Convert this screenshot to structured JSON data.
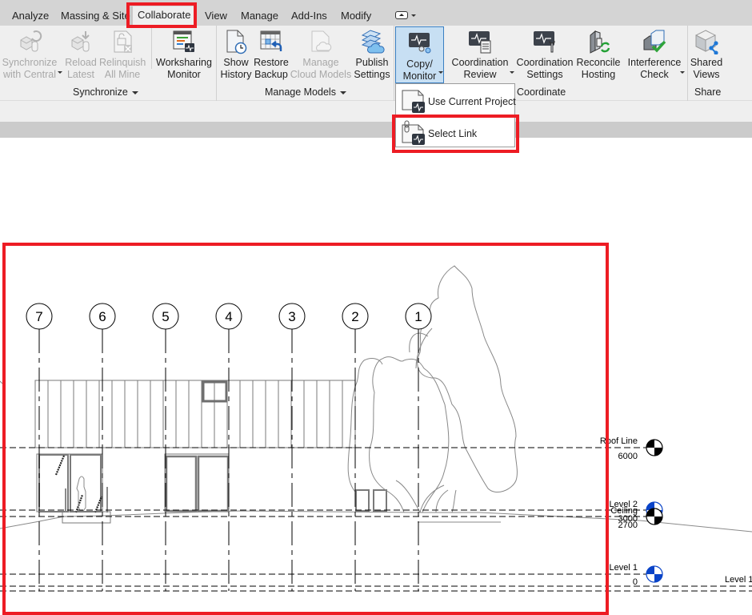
{
  "tabs": [
    {
      "label": "Analyze",
      "active": false
    },
    {
      "label": "Massing & Site",
      "active": false
    },
    {
      "label": "Collaborate",
      "active": true
    },
    {
      "label": "View",
      "active": false
    },
    {
      "label": "Manage",
      "active": false
    },
    {
      "label": "Add-Ins",
      "active": false
    },
    {
      "label": "Modify",
      "active": false
    }
  ],
  "quick_access": {
    "icon": "contextual-tab-toggle-icon"
  },
  "ribbon": {
    "panels": {
      "synchronize": {
        "title": "Synchronize",
        "buttons": [
          {
            "line1": "Synchronize",
            "line2": "with Central",
            "enabled": false,
            "split": true,
            "icon": "synchronize-icon"
          },
          {
            "line1": "Reload",
            "line2": "Latest",
            "enabled": false,
            "icon": "reload-latest-icon"
          },
          {
            "line1": "Relinquish",
            "line2": "All Mine",
            "enabled": false,
            "icon": "relinquish-icon"
          },
          {
            "line1": "Worksharing",
            "line2": "Monitor",
            "enabled": true,
            "icon": "worksharing-monitor-icon"
          }
        ]
      },
      "manage_models": {
        "title": "Manage Models",
        "buttons": [
          {
            "line1": "Show",
            "line2": "History",
            "enabled": true,
            "icon": "show-history-icon"
          },
          {
            "line1": "Restore",
            "line2": "Backup",
            "enabled": true,
            "icon": "restore-backup-icon"
          },
          {
            "line1": "Manage",
            "line2": "Cloud Models",
            "enabled": false,
            "icon": "cloud-models-icon"
          },
          {
            "line1": "Publish",
            "line2": "Settings",
            "enabled": true,
            "icon": "publish-settings-icon"
          }
        ]
      },
      "coordinate": {
        "title": "Coordinate",
        "buttons": [
          {
            "line1": "Copy/",
            "line2": "Monitor",
            "enabled": true,
            "selected": true,
            "split": true,
            "icon": "copy-monitor-icon"
          },
          {
            "line1": "Coordination",
            "line2": "Review",
            "enabled": true,
            "split": true,
            "icon": "coordination-review-icon"
          },
          {
            "line1": "Coordination",
            "line2": "Settings",
            "enabled": true,
            "icon": "coordination-settings-icon"
          },
          {
            "line1": "Reconcile",
            "line2": "Hosting",
            "enabled": true,
            "icon": "reconcile-hosting-icon"
          },
          {
            "line1": "Interference",
            "line2": "Check",
            "enabled": true,
            "split": true,
            "icon": "interference-check-icon"
          }
        ]
      },
      "share": {
        "title": "Share",
        "buttons": [
          {
            "line1": "Shared",
            "line2": "Views",
            "enabled": true,
            "icon": "shared-views-icon"
          }
        ]
      }
    }
  },
  "dropdown": {
    "items": [
      {
        "label": "Use Current Project",
        "icon": "use-current-project-icon"
      },
      {
        "label": "Select Link",
        "icon": "select-link-icon",
        "highlighted": true
      }
    ]
  },
  "highlight_color": "#ed1c24",
  "drawing": {
    "grids": [
      "7",
      "6",
      "5",
      "4",
      "3",
      "2",
      "1"
    ],
    "levels": [
      {
        "name": "Roof Line",
        "elevation": "6000",
        "marker": "black"
      },
      {
        "name": "Level 2",
        "elevation": "3000",
        "marker": "blue"
      },
      {
        "name": "Ceiling",
        "elevation": "2700",
        "marker": "black"
      },
      {
        "name": "Level 1",
        "elevation": "0",
        "marker": "blue"
      }
    ],
    "offscreen_level_label": "Level 1"
  },
  "colors": {
    "level_blue": "#0a44c8",
    "selected_button_bg": "#c7dff3",
    "selected_button_border": "#3a7fc1"
  }
}
